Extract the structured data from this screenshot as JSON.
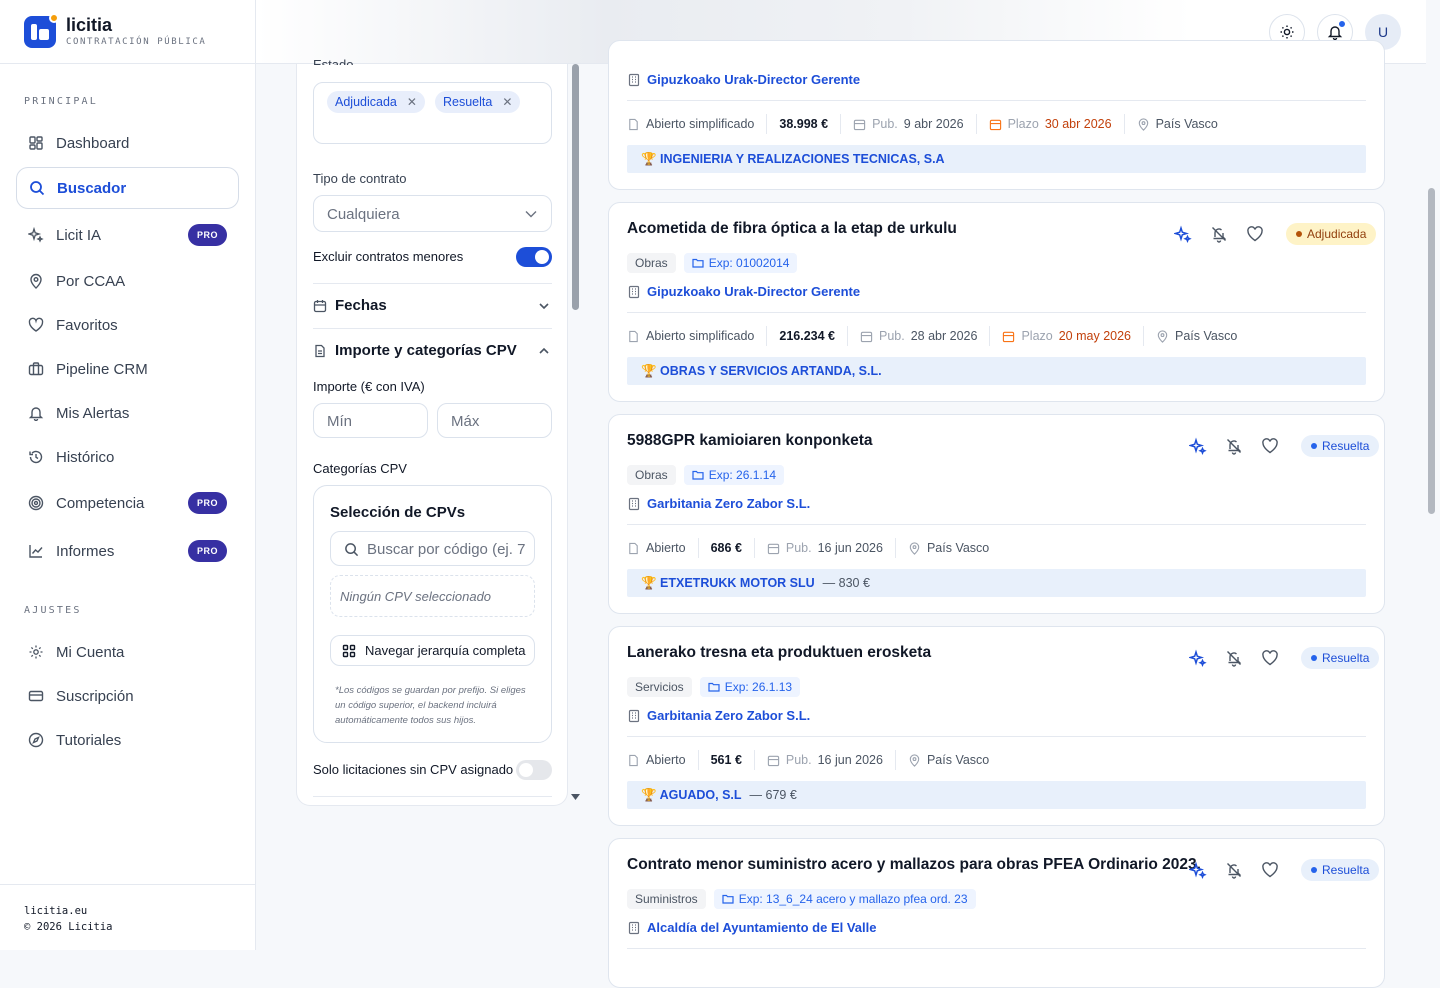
{
  "brand": {
    "name": "licitia",
    "subtitle": "CONTRATACIÓN PÚBLICA"
  },
  "sidebar": {
    "section_main": "PRINCIPAL",
    "section_settings": "AJUSTES",
    "items": [
      {
        "label": "Dashboard",
        "icon": "grid-icon"
      },
      {
        "label": "Buscador",
        "icon": "search-icon",
        "active": true
      },
      {
        "label": "Licit IA",
        "icon": "sparkles-icon",
        "badge": "PRO"
      },
      {
        "label": "Por CCAA",
        "icon": "map-pin-icon"
      },
      {
        "label": "Favoritos",
        "icon": "heart-icon"
      },
      {
        "label": "Pipeline CRM",
        "icon": "briefcase-icon"
      },
      {
        "label": "Mis Alertas",
        "icon": "bell-icon"
      },
      {
        "label": "Histórico",
        "icon": "history-icon"
      },
      {
        "label": "Competencia",
        "icon": "target-icon",
        "badge": "PRO"
      },
      {
        "label": "Informes",
        "icon": "line-chart-icon",
        "badge": "PRO"
      }
    ],
    "settings": [
      {
        "label": "Mi Cuenta",
        "icon": "gear-icon"
      },
      {
        "label": "Suscripción",
        "icon": "credit-card-icon"
      },
      {
        "label": "Tutoriales",
        "icon": "compass-icon"
      }
    ],
    "footer": {
      "site": "licitia.eu",
      "copyright": "© 2026 Licitia"
    }
  },
  "topbar": {
    "avatar_initial": "U"
  },
  "filters": {
    "estado_label": "Estado",
    "estado_chips": [
      "Adjudicada",
      "Resuelta"
    ],
    "tipo_label": "Tipo de contrato",
    "tipo_value": "Cualquiera",
    "excluir_label": "Excluir contratos menores",
    "excluir_on": true,
    "fechas_label": "Fechas",
    "importe_section": "Importe y categorías CPV",
    "importe_label": "Importe (€ con IVA)",
    "min_placeholder": "Mín",
    "max_placeholder": "Máx",
    "cpv_label": "Categorías CPV",
    "cpv_title": "Selección de CPVs",
    "cpv_search_placeholder": "Buscar por código (ej. 7",
    "cpv_none": "Ningún CPV seleccionado",
    "cpv_nav": "Navegar jerarquía completa",
    "cpv_note": "*Los códigos se guardan por prefijo. Si eliges un código superior, el backend incluirá automáticamente todos sus hijos.",
    "solo_label": "Solo licitaciones sin CPV asignado",
    "solo_on": false
  },
  "results": [
    {
      "org": "Gipuzkoako Urak-Director Gerente",
      "procedure": "Abierto simplificado",
      "amount": "38.998 €",
      "pub_label": "Pub.",
      "pub": "9 abr 2026",
      "plazo_label": "Plazo",
      "plazo": "30 abr 2026",
      "region": "País Vasco",
      "winner": "🏆 INGENIERIA Y REALIZACIONES TECNICAS, S.A",
      "winner_amount": ""
    },
    {
      "title": "Acometida de fibra óptica a la etap de urkulu",
      "type": "Obras",
      "exp": "Exp: 01002014",
      "org": "Gipuzkoako Urak-Director Gerente",
      "procedure": "Abierto simplificado",
      "amount": "216.234 €",
      "pub_label": "Pub.",
      "pub": "28 abr 2026",
      "plazo_label": "Plazo",
      "plazo": "20 may 2026",
      "region": "País Vasco",
      "winner": "🏆 OBRAS Y SERVICIOS ARTANDA, S.L.",
      "winner_amount": "",
      "status": "Adjudicada"
    },
    {
      "title": "5988GPR kamioiaren konponketa",
      "type": "Obras",
      "exp": "Exp: 26.1.14",
      "org": "Garbitania Zero Zabor S.L.",
      "procedure": "Abierto",
      "amount": "686 €",
      "pub_label": "Pub.",
      "pub": "16 jun 2026",
      "region": "País Vasco",
      "winner": "🏆 ETXETRUKK MOTOR SLU",
      "winner_amount": "— 830 €",
      "status": "Resuelta"
    },
    {
      "title": "Lanerako tresna eta produktuen erosketa",
      "type": "Servicios",
      "exp": "Exp: 26.1.13",
      "org": "Garbitania Zero Zabor S.L.",
      "procedure": "Abierto",
      "amount": "561 €",
      "pub_label": "Pub.",
      "pub": "16 jun 2026",
      "region": "País Vasco",
      "winner": "🏆 AGUADO, S.L",
      "winner_amount": "— 679 €",
      "status": "Resuelta"
    },
    {
      "title": "Contrato menor suministro acero y mallazos para obras PFEA Ordinario 2023.",
      "type": "Suministros",
      "exp": "Exp: 13_6_24 acero y mallazo pfea ord. 23",
      "org": "Alcaldía del Ayuntamiento de El Valle",
      "status": "Resuelta"
    }
  ],
  "colors": {
    "accent": "#1d4ed8",
    "pro_badge": "#3730a3",
    "toggle_on": "#1d4ed8",
    "adjudicada_bg": "#fef3c7",
    "resuelta_bg": "#e8f0fb"
  }
}
